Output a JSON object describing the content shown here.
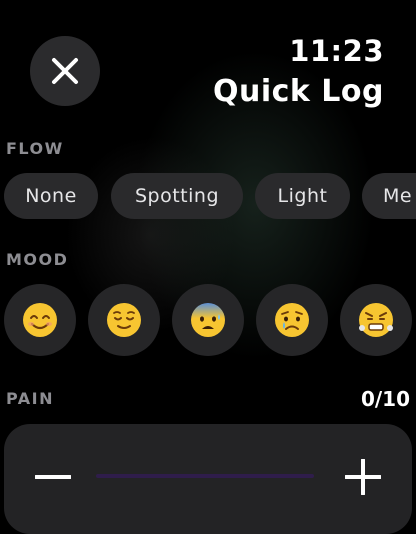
{
  "header": {
    "time": "11:23",
    "title": "Quick Log",
    "close_icon": "close-icon"
  },
  "flow": {
    "label": "FLOW",
    "options": [
      "None",
      "Spotting",
      "Light",
      "Me"
    ]
  },
  "mood": {
    "label": "MOOD",
    "options": [
      "😊",
      "😌",
      "😰",
      "😢",
      "😤"
    ]
  },
  "pain": {
    "label": "PAIN",
    "value_text": "0/10",
    "level": 0,
    "max": 10,
    "decrease_icon": "minus-icon",
    "increase_icon": "plus-icon",
    "accent": "#7b4fd1"
  }
}
